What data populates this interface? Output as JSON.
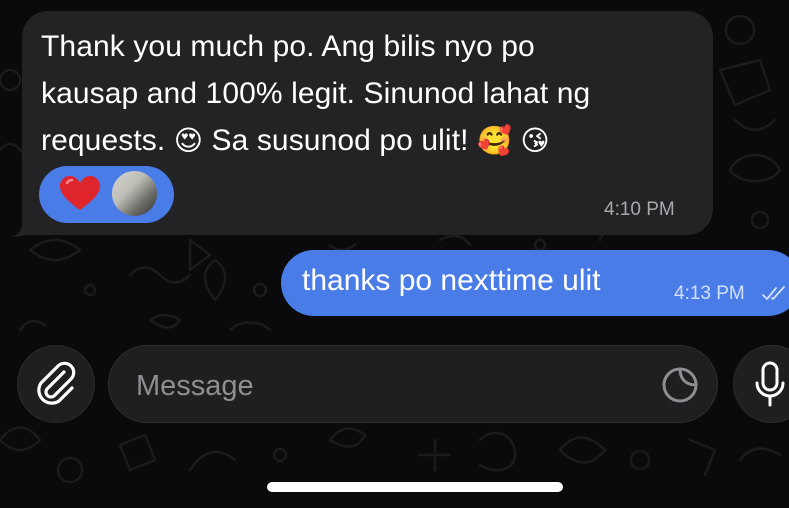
{
  "chat": {
    "incoming": {
      "line1": "Thank you much po. Ang bilis nyo po",
      "line2": "kausap and 100% legit. Sinunod lahat ng",
      "line3_a": "requests.",
      "line3_emoji1": "😍",
      "line3_b": "Sa susunod po ulit!",
      "line3_emoji2": "🥰",
      "line3_emoji3": "😘",
      "time": "4:10 PM",
      "reaction": {
        "emoji_icon": "heart-icon",
        "color": "#e0242b",
        "pill_color": "#4a7ce8"
      }
    },
    "outgoing": {
      "text": "thanks po nexttime ulit",
      "time": "4:13 PM",
      "status_icon": "double-check-icon"
    }
  },
  "composer": {
    "placeholder": "Message",
    "attach_icon": "paperclip-icon",
    "sticker_icon": "sticker-icon",
    "mic_icon": "microphone-icon"
  },
  "colors": {
    "background": "#0a0a0c",
    "incoming_bubble": "#232326",
    "outgoing_bubble": "#4a7ce8",
    "muted_text": "#a7a7ad"
  }
}
